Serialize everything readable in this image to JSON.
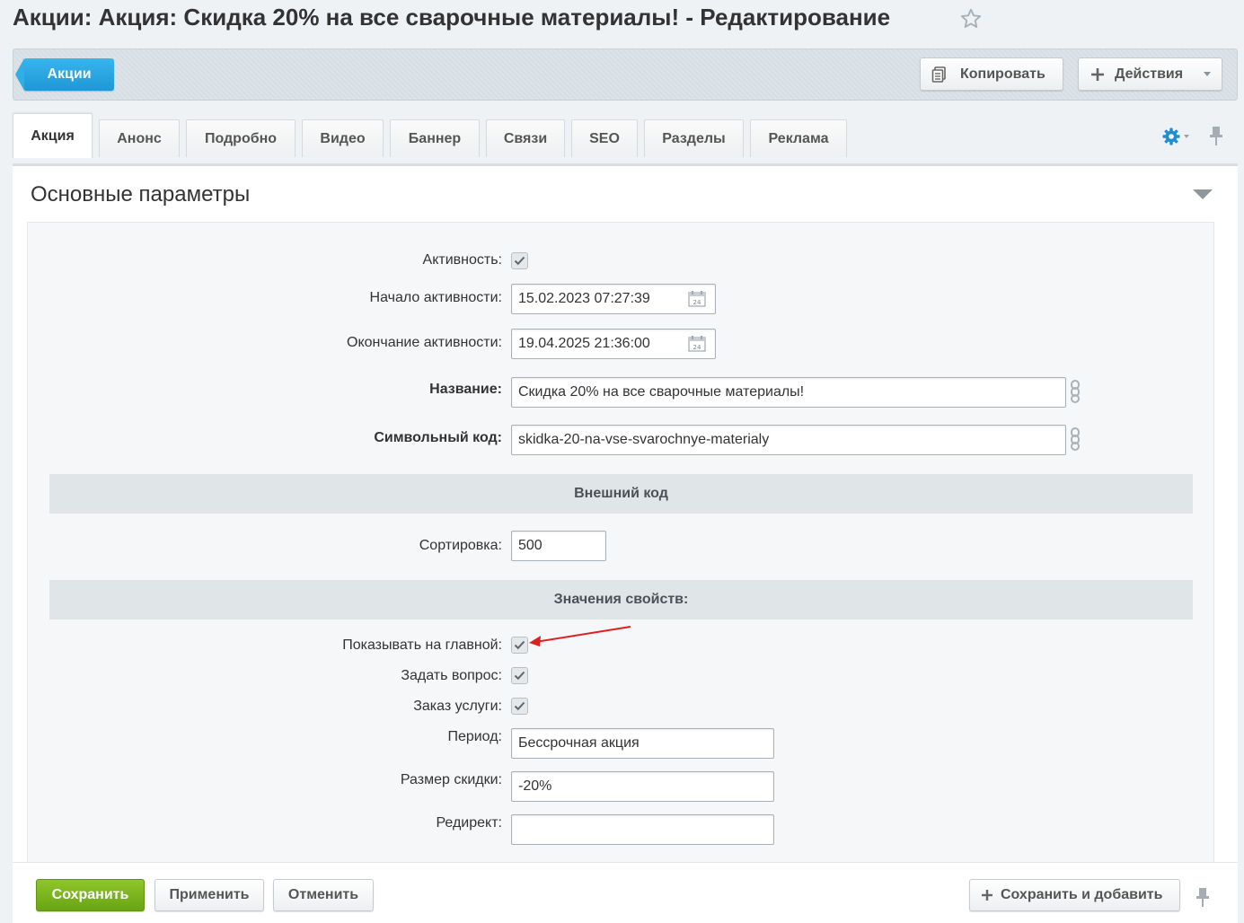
{
  "page": {
    "title": "Акции: Акция: Скидка 20% на все сварочные материалы! - Редактирование",
    "favorite_icon": "star-icon"
  },
  "toolbar": {
    "back_label": "Акции",
    "copy_label": "Копировать",
    "actions_label": "Действия"
  },
  "tabs": [
    {
      "label": "Акция",
      "active": true
    },
    {
      "label": "Анонс"
    },
    {
      "label": "Подробно"
    },
    {
      "label": "Видео"
    },
    {
      "label": "Баннер"
    },
    {
      "label": "Связи"
    },
    {
      "label": "SEO"
    },
    {
      "label": "Разделы"
    },
    {
      "label": "Реклама"
    }
  ],
  "section": {
    "title": "Основные параметры"
  },
  "form": {
    "active": {
      "label": "Активность:",
      "checked": true
    },
    "start": {
      "label": "Начало активности:",
      "value": "15.02.2023 07:27:39"
    },
    "end": {
      "label": "Окончание активности:",
      "value": "19.04.2025 21:36:00"
    },
    "name": {
      "label": "Название:",
      "value": "Скидка 20% на все сварочные материалы!"
    },
    "code": {
      "label": "Символьный код:",
      "value": "skidka-20-na-vse-svarochnye-materialy"
    },
    "external_code_header": "Внешний код",
    "sort": {
      "label": "Сортировка:",
      "value": "500"
    },
    "props_header": "Значения свойств:",
    "show_main": {
      "label": "Показывать на главной:",
      "checked": true
    },
    "ask_question": {
      "label": "Задать вопрос:",
      "checked": true
    },
    "order_service": {
      "label": "Заказ услуги:",
      "checked": true
    },
    "period": {
      "label": "Период:",
      "value": "Бессрочная акция"
    },
    "discount": {
      "label": "Размер скидки:",
      "value": "-20%"
    },
    "redirect": {
      "label": "Редирект:",
      "value": ""
    }
  },
  "footer": {
    "save_label": "Сохранить",
    "apply_label": "Применить",
    "cancel_label": "Отменить",
    "save_add_label": "Сохранить и добавить"
  },
  "colors": {
    "accent_blue": "#1c98d6",
    "save_green": "#6aa414",
    "annotation_red": "#e02020"
  }
}
